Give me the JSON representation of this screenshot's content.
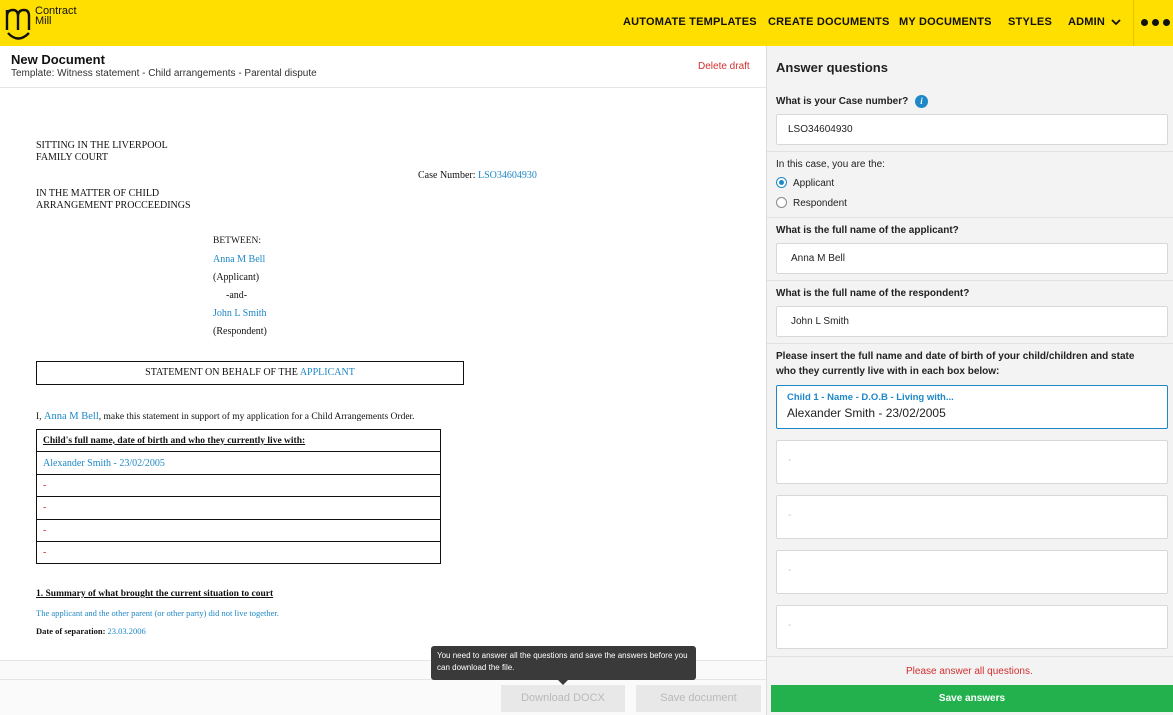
{
  "brand": {
    "name_line1": "Contract",
    "name_line2": "Mill"
  },
  "nav": {
    "items": [
      "AUTOMATE TEMPLATES",
      "CREATE DOCUMENTS",
      "MY DOCUMENTS",
      "STYLES",
      "ADMIN"
    ],
    "more_icon": "ellipsis-icon"
  },
  "document": {
    "title": "New Document",
    "template": "Template: Witness statement - Child arrangements - Parental dispute",
    "delete_label": "Delete draft",
    "court_line1": "SITTING IN THE LIVERPOOL",
    "court_line2": "FAMILY COURT",
    "case_number_label": "Case Number: ",
    "case_number": "LSO34604930",
    "matter_line1": "IN THE MATTER OF CHILD",
    "matter_line2": "ARRANGEMENT PROCCEEDINGS",
    "between": "BETWEEN:",
    "applicant_name": "Anna M Bell",
    "applicant_role": "(Applicant)",
    "and": "-and-",
    "respondent_name": "John L Smith",
    "respondent_role": "(Respondent)",
    "statement_prefix": "STATEMENT ON BEHALF OF THE ",
    "statement_party": "APPLICANT",
    "intro_prefix": "I, ",
    "intro_name": "Anna M Bell",
    "intro_suffix": ", make this statement in support of my application for a Child Arrangements Order.",
    "table_header": "Child's full name, date of birth and who they currently live with:",
    "table_rows": [
      "Alexander Smith - 23/02/2005",
      "-",
      "-",
      "-",
      "-"
    ],
    "section1_title": "1. Summary of what brought the current situation to court",
    "section1_text": "The applicant and the other parent (or other party) did not live together.",
    "separation_label": "Date of separation: ",
    "separation_date": "23.03.2006"
  },
  "tooltip": "You need to answer all the questions and save the answers before you can download the file.",
  "buttons": {
    "download": "Download DOCX",
    "save_document": "Save document",
    "save_answers": "Save answers"
  },
  "panel": {
    "title": "Answer questions",
    "q_case": "What is your Case number?",
    "case_value": "LSO34604930",
    "q_role": "In this case, you are the:",
    "role_options": [
      "Applicant",
      "Respondent"
    ],
    "role_selected": "Applicant",
    "q_applicant": "What is the full name of the applicant?",
    "applicant_value": "Anna M Bell",
    "q_respondent": "What is the full name of the respondent?",
    "respondent_value": "John L Smith",
    "q_children_line1": "Please insert the full name and date of birth of your child/children and state",
    "q_children_line2": "who they currently live with in each box below:",
    "child1_label": "Child 1 - Name - D.O.B - Living with...",
    "child1_value": "Alexander Smith - 23/02/2005",
    "other_children": [
      "-",
      "-",
      "-",
      "-"
    ],
    "error": "Please answer all questions."
  },
  "colors": {
    "brand_yellow": "#ffdf00",
    "link_blue": "#1e88c7",
    "error_red": "#d32f2f",
    "save_green": "#22b14c"
  }
}
